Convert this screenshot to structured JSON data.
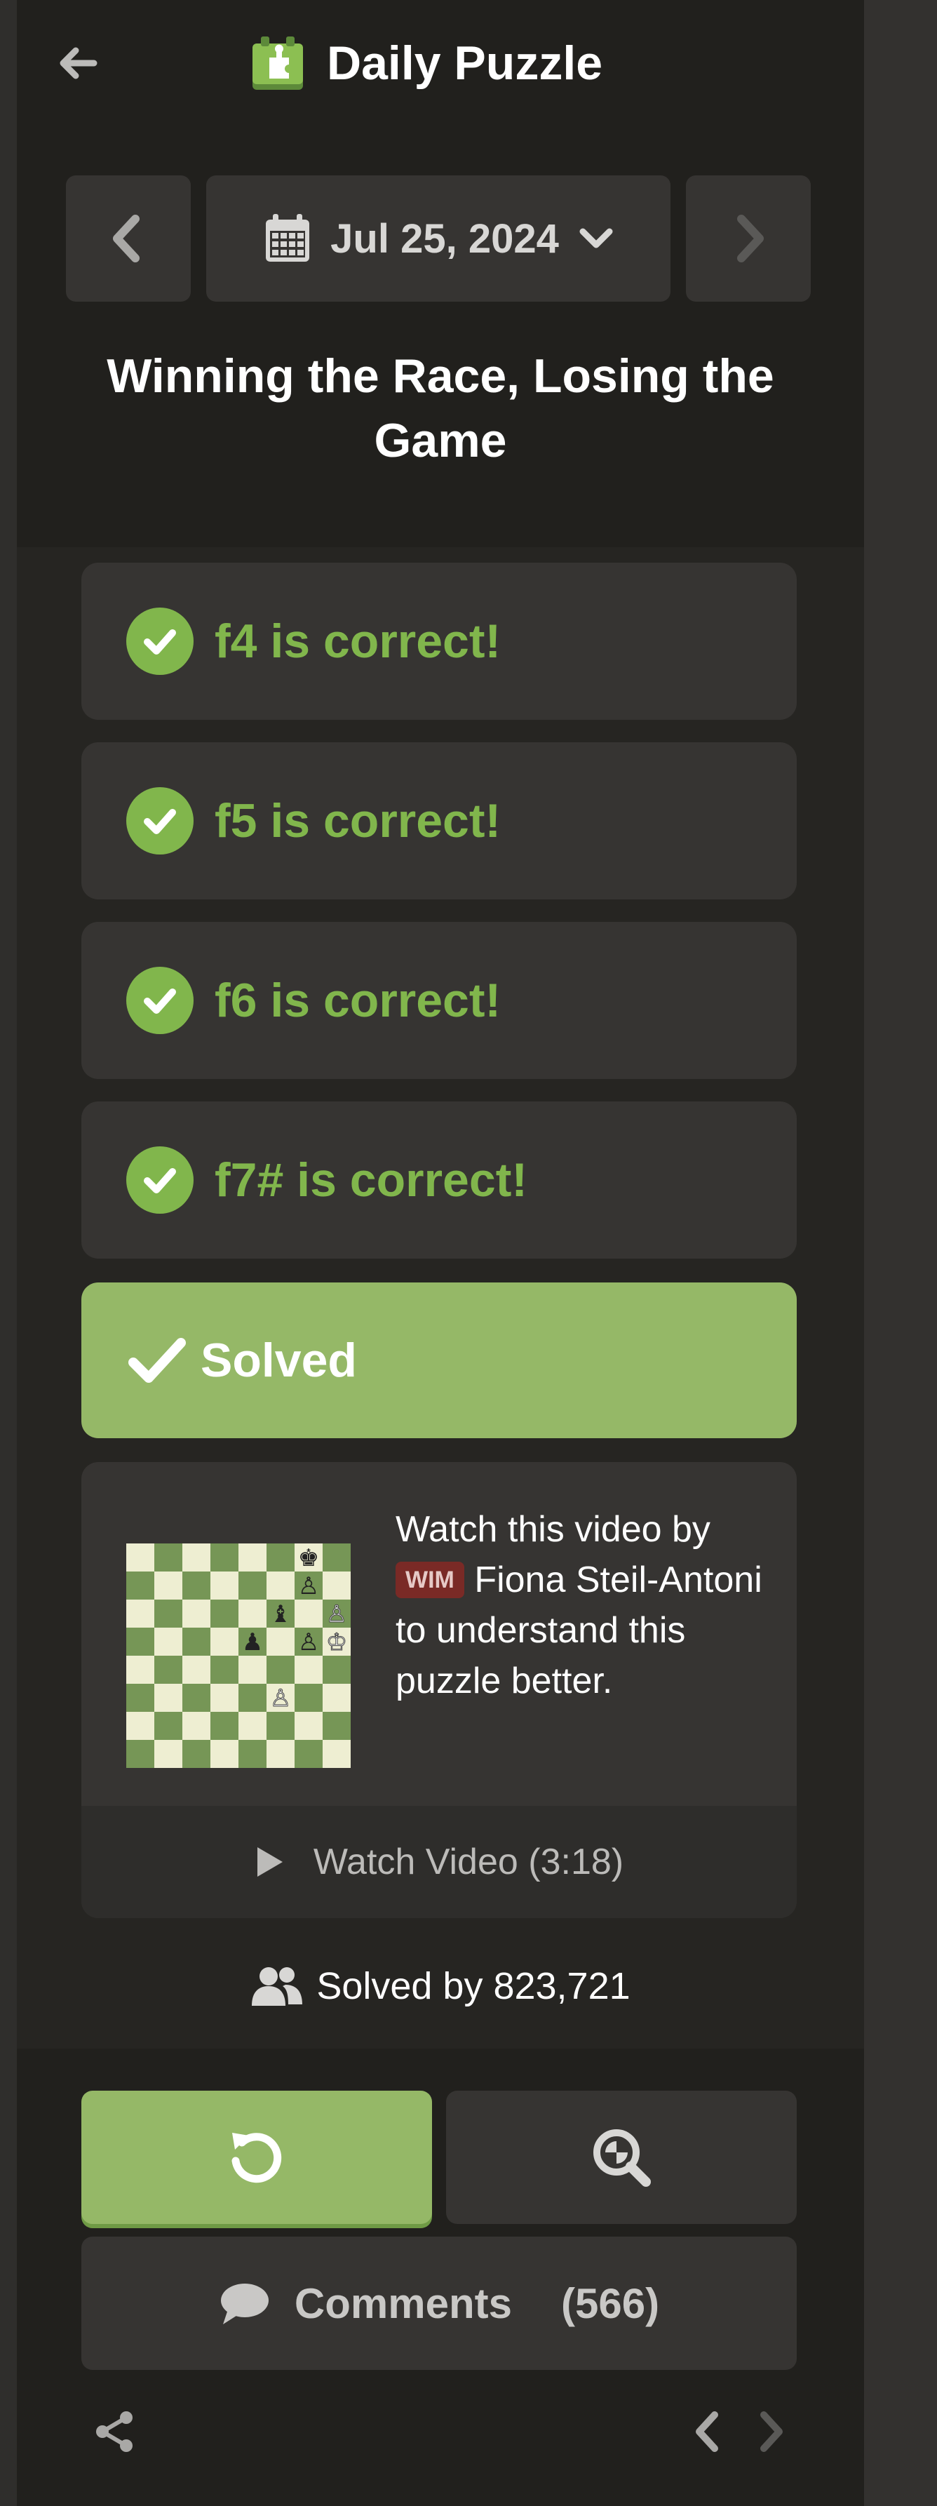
{
  "header": {
    "title": "Daily Puzzle",
    "date": "Jul 25, 2024",
    "puzzle_title": "Winning the Race, Losing the Game"
  },
  "moves": [
    {
      "text": "f4 is correct!"
    },
    {
      "text": "f5 is correct!"
    },
    {
      "text": "f6 is correct!"
    },
    {
      "text": "f7# is correct!"
    }
  ],
  "status": {
    "solved_label": "Solved"
  },
  "video": {
    "line_start": "Watch this video by",
    "badge": "WIM",
    "author": "Fiona Steil-Antoni",
    "line_end": "to understand this puzzle better.",
    "watch_label": "Watch Video (3:18)"
  },
  "stats": {
    "solved_by": "Solved by 823,721"
  },
  "actions": {
    "comments_label": "Comments",
    "comments_count": "(566)"
  },
  "colors": {
    "accent_green": "#81b64c",
    "solved_green": "#95b867",
    "card_bg": "#363432",
    "panel_bg": "#262522",
    "board_dark": "#769656",
    "board_light": "#eeeed2"
  },
  "icons": [
    "back-arrow-icon",
    "puzzle-piece-icon",
    "chevron-left-icon",
    "calendar-icon",
    "chevron-down-icon",
    "chevron-right-icon",
    "check-circle-icon",
    "checkmark-icon",
    "play-icon",
    "users-icon",
    "retry-icon",
    "analysis-icon",
    "comment-icon",
    "share-icon"
  ]
}
